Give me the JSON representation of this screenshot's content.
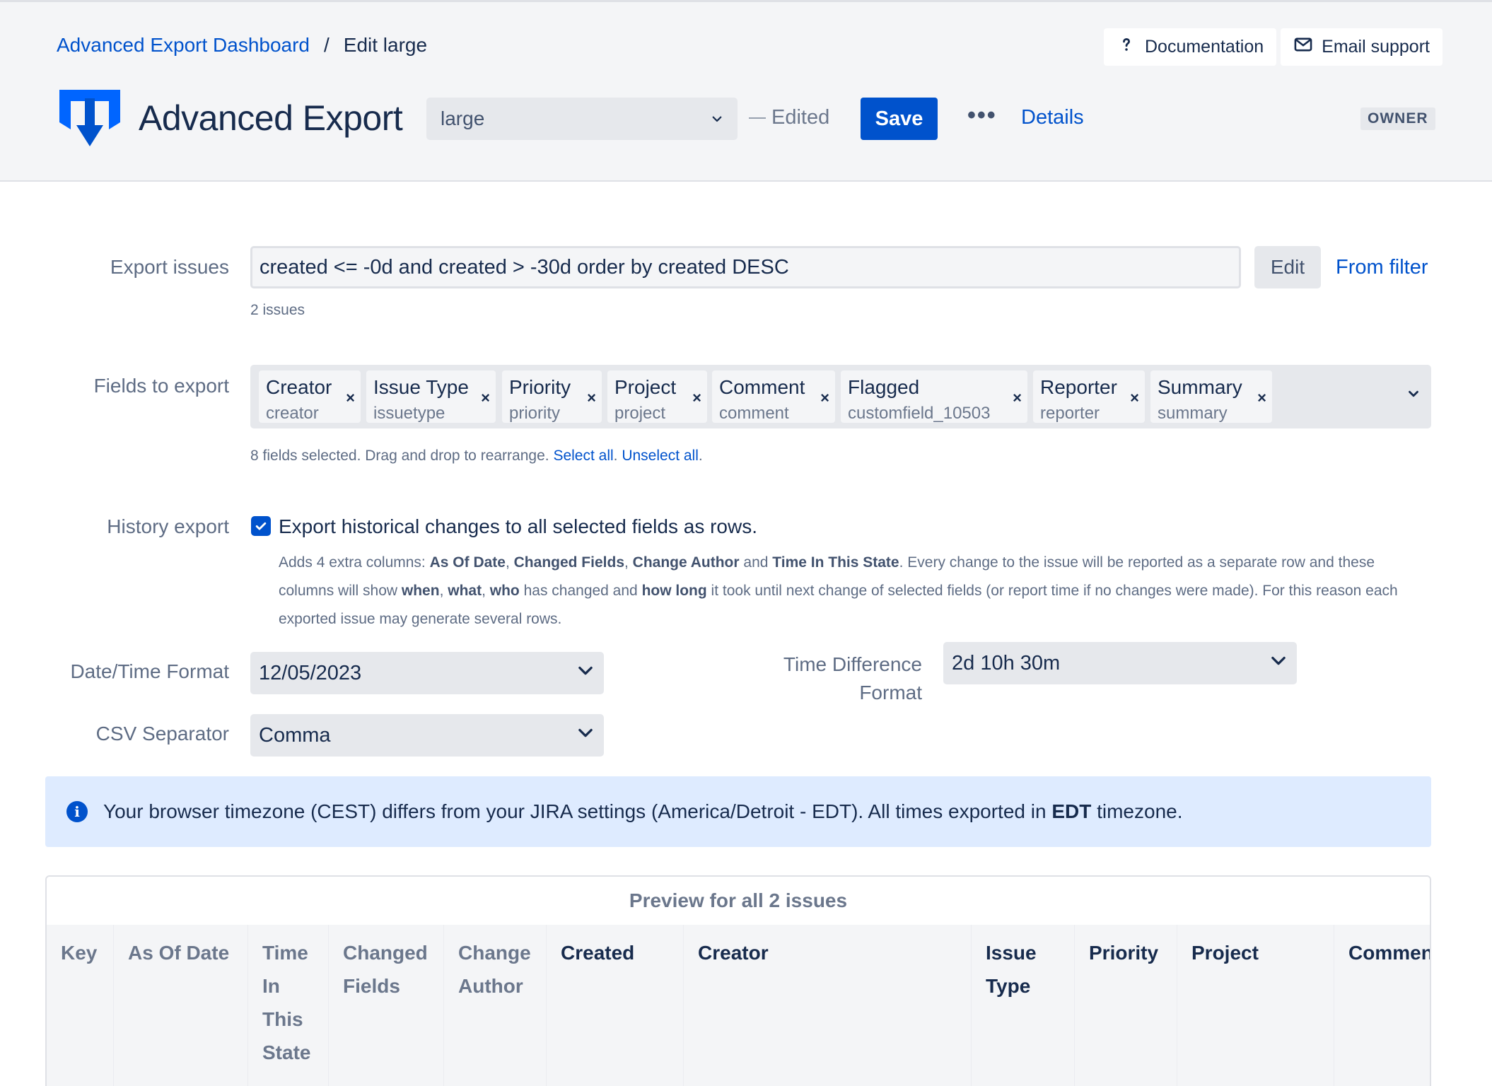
{
  "breadcrumb": {
    "parent": "Advanced Export Dashboard",
    "separator": "/",
    "current": "Edit large"
  },
  "help": {
    "documentation": "Documentation",
    "email_support": "Email support"
  },
  "app": {
    "title": "Advanced Export"
  },
  "toolbar": {
    "config_selected": "large",
    "edited_label": "Edited",
    "save_label": "Save",
    "more_label": "•••",
    "details_label": "Details",
    "role_badge": "OWNER"
  },
  "export_issues": {
    "label": "Export issues",
    "jql": "created <= -0d and created > -30d order by created DESC",
    "edit_label": "Edit",
    "from_filter_label": "From filter",
    "count_text": "2 issues"
  },
  "fields": {
    "label": "Fields to export",
    "chips": [
      {
        "name": "Creator",
        "id": "creator"
      },
      {
        "name": "Issue Type",
        "id": "issuetype"
      },
      {
        "name": "Priority",
        "id": "priority"
      },
      {
        "name": "Project",
        "id": "project"
      },
      {
        "name": "Comment",
        "id": "comment"
      },
      {
        "name": "Flagged",
        "id": "customfield_10503"
      },
      {
        "name": "Reporter",
        "id": "reporter"
      },
      {
        "name": "Summary",
        "id": "summary"
      }
    ],
    "remove_glyph": "×",
    "info_text": "8 fields selected. Drag and drop to rearrange.",
    "select_all": "Select all",
    "unselect_all": "Unselect all"
  },
  "history": {
    "label": "History export",
    "checked": true,
    "checkbox_label": "Export historical changes to all selected fields as rows.",
    "desc": {
      "p1": "Adds 4 extra columns: ",
      "b1": "As Of Date",
      "p2": ", ",
      "b2": "Changed Fields",
      "p3": ", ",
      "b3": "Change Author",
      "p4": " and ",
      "b4": "Time In This State",
      "p5": ". Every change to the issue will be reported as a separate row and these columns will show ",
      "b5": "when",
      "p6": ", ",
      "b6": "what",
      "p7": ", ",
      "b7": "who",
      "p8": " has changed and ",
      "b8": "how long",
      "p9": " it took until next change of selected fields (or report time if no changes were made). For this reason each exported issue may generate several rows."
    }
  },
  "date_format": {
    "label": "Date/Time Format",
    "value": "12/05/2023"
  },
  "time_diff": {
    "label_line1": "Time Difference",
    "label_line2": "Format",
    "value": "2d 10h 30m"
  },
  "csv": {
    "label": "CSV Separator",
    "value": "Comma"
  },
  "banner": {
    "text_before": "Your browser timezone (CEST) differs from your JIRA settings (America/Detroit - EDT). All times exported in ",
    "bold": "EDT",
    "text_after": " timezone."
  },
  "preview": {
    "title": "Preview for all 2 issues",
    "columns": [
      {
        "lines": [
          "Key"
        ],
        "kind": "hist"
      },
      {
        "lines": [
          "As Of Date"
        ],
        "kind": "hist"
      },
      {
        "lines": [
          "Time",
          "In",
          "This",
          "State"
        ],
        "kind": "hist"
      },
      {
        "lines": [
          "Changed",
          "Fields"
        ],
        "kind": "hist"
      },
      {
        "lines": [
          "Change",
          "Author"
        ],
        "kind": "hist"
      },
      {
        "lines": [
          "Created"
        ],
        "kind": "fld"
      },
      {
        "lines": [
          "Creator"
        ],
        "kind": "fld"
      },
      {
        "lines": [
          "Issue",
          "Type"
        ],
        "kind": "fld"
      },
      {
        "lines": [
          "Priority"
        ],
        "kind": "fld"
      },
      {
        "lines": [
          "Project"
        ],
        "kind": "fld"
      },
      {
        "lines": [
          "Comment"
        ],
        "kind": "fld"
      }
    ]
  },
  "colors": {
    "primary": "#0052cc",
    "header_bg": "#f4f5f7",
    "banner_bg": "#deebff",
    "text": "#172b4d",
    "muted": "#5e6c84"
  }
}
